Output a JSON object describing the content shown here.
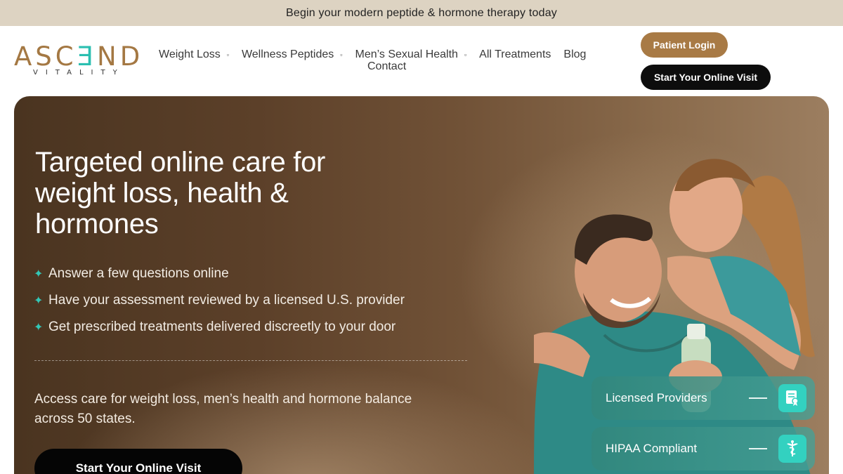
{
  "announcement": "Begin your modern peptide & hormone therapy today",
  "logo": {
    "word_a": "ASC",
    "word_b": "Ǝ",
    "word_c": "ND",
    "sub": "VITALITY"
  },
  "nav": {
    "items": [
      {
        "label": "Weight Loss",
        "has_menu": true
      },
      {
        "label": "Wellness Peptides",
        "has_menu": true
      },
      {
        "label": "Men’s Sexual Health",
        "has_menu": true
      },
      {
        "label": "All Treatments",
        "has_menu": false
      },
      {
        "label": "Blog",
        "has_menu": false
      }
    ],
    "second_row": "Contact",
    "caret_glyph": "▫"
  },
  "header_buttons": {
    "login": "Patient Login",
    "visit": "Start Your Online Visit"
  },
  "hero": {
    "title": "Targeted online care for weight loss, health & hormones",
    "bullets": [
      "Answer a few questions online",
      "Have your assessment reviewed by a licensed U.S. provider",
      "Get prescribed treatments delivered discreetly to your door"
    ],
    "bullet_glyph": "✦",
    "sub_copy": "Access care for weight loss, men’s health and hormone balance across 50 states.",
    "cta": "Start Your Online Visit",
    "badges": [
      {
        "label": "Licensed Providers",
        "icon": "certificate-icon"
      },
      {
        "label": "HIPAA Compliant",
        "icon": "caduceus-icon"
      }
    ]
  },
  "colors": {
    "announcement_bg": "#ddd3c2",
    "brand_gold": "#a47843",
    "brand_teal": "#2bbfb0",
    "cta_dark": "#0d0d0d"
  }
}
